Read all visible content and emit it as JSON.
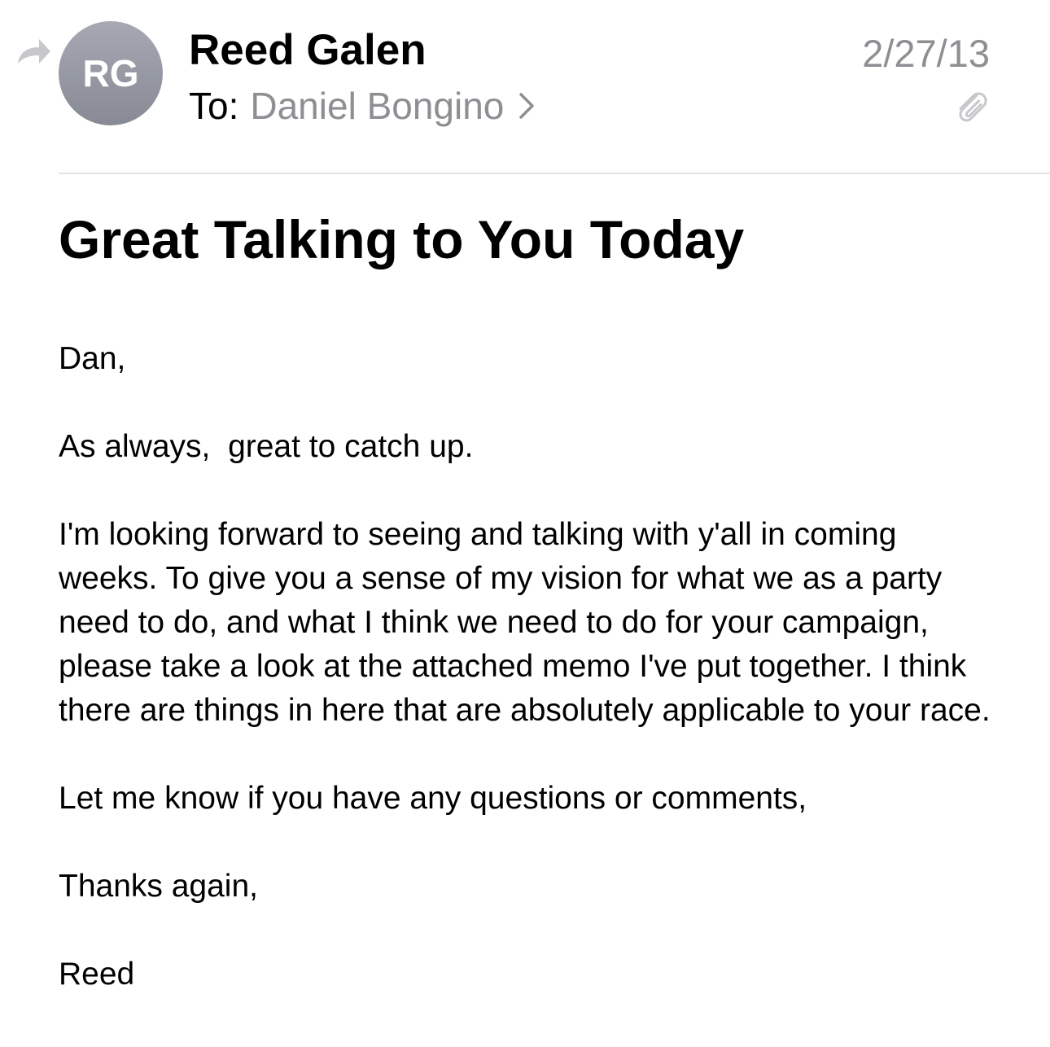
{
  "header": {
    "avatar_initials": "RG",
    "sender": "Reed Galen",
    "to_label": "To:",
    "recipient": "Daniel Bongino",
    "date": "2/27/13",
    "icons": [
      "reply-arrow-icon",
      "chevron-right-icon",
      "paperclip-icon"
    ]
  },
  "message": {
    "subject": "Great Talking to You Today",
    "greeting": "Dan,",
    "paragraph_1": "As always,  great to catch up.",
    "paragraph_2": "I'm looking forward to seeing and talking with y'all in coming weeks. To give you a sense of my vision for what we as a party need to do, and what I think we need to do for your campaign, please take a look at the attached memo I've put together. I think there are things in here that are absolutely applicable to your race.",
    "paragraph_3": "Let me know if you have any questions or comments,",
    "closing": "Thanks again,",
    "signature": "Reed"
  },
  "colors": {
    "secondary_text": "#8e8e93",
    "avatar": "#8e9099",
    "divider": "#e3e3e6"
  }
}
